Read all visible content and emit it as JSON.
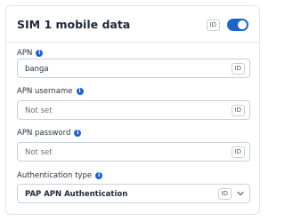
{
  "header": {
    "title": "SIM 1 mobile data",
    "id_chip": "ID",
    "toggle_on": true
  },
  "fields": [
    {
      "label": "APN",
      "value": "banga",
      "placeholder": "",
      "id_chip": "ID"
    },
    {
      "label": "APN username",
      "value": "",
      "placeholder": "Not set",
      "id_chip": "ID"
    },
    {
      "label": "APN password",
      "value": "",
      "placeholder": "Not set",
      "id_chip": "ID"
    }
  ],
  "auth": {
    "label": "Authentication type",
    "selected": "PAP APN Authentication",
    "id_chip": "ID"
  },
  "info_icon_glyph": "i",
  "colors": {
    "accent": "#1f63c8",
    "border": "#c9cfd8"
  }
}
